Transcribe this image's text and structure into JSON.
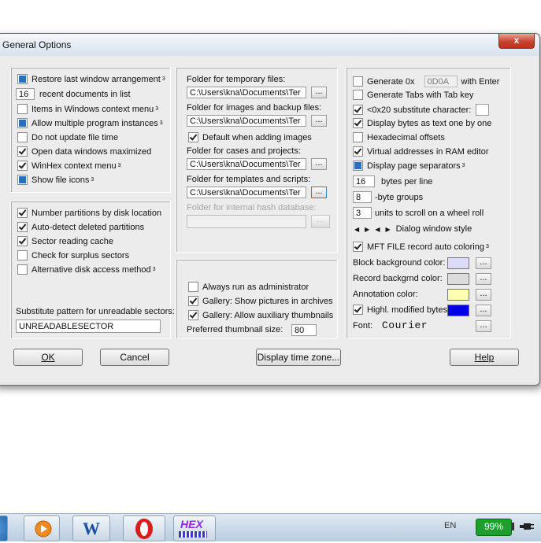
{
  "dialog": {
    "title": "General Options",
    "close_glyph": "x",
    "left_top": {
      "restore_last_window": "Restore last window arrangement",
      "restore_sup": "3",
      "recent_count": "16",
      "recent_label": "recent documents in list",
      "context_menu": "Items in Windows context menu",
      "context_sup": "3",
      "multiple_instances": "Allow multiple program instances",
      "multiple_sup": "3",
      "no_update_time": "Do not update file time",
      "open_maximized": "Open data windows maximized",
      "winhex_context": "WinHex context menu",
      "winhex_sup": "3",
      "show_icons": "Show file icons",
      "icons_sup": "3"
    },
    "left_bottom": {
      "number_partitions": "Number partitions by disk location",
      "auto_detect": "Auto-detect deleted partitions",
      "sector_cache": "Sector reading cache",
      "surplus": "Check for surplus sectors",
      "alt_access": "Alternative disk access method",
      "alt_sup": "3",
      "substitute_label": "Substitute pattern for unreadable sectors:",
      "substitute_value": "UNREADABLESECTOR"
    },
    "middle_top": {
      "temp_label": "Folder for temporary files:",
      "temp_value": "C:\\Users\\kna\\Documents\\Ter",
      "images_label": "Folder for images and backup files:",
      "images_value": "C:\\Users\\kna\\Documents\\Ter",
      "default_adding": "Default when adding images",
      "cases_label": "Folder for cases and projects:",
      "cases_value": "C:\\Users\\kna\\Documents\\Ter",
      "templates_label": "Folder for templates and scripts:",
      "templates_value": "C:\\Users\\kna\\Documents\\Ter",
      "hash_label": "Folder for internal hash database:",
      "hash_value": "",
      "browse": "..."
    },
    "middle_bottom": {
      "run_admin": "Always run as administrator",
      "gallery_archives": "Gallery: Show pictures in archives",
      "gallery_aux": "Gallery: Allow auxiliary thumbnails",
      "thumb_label": "Preferred thumbnail size:",
      "thumb_value": "80"
    },
    "right": {
      "generate_0x": "Generate 0x",
      "generate_0x_value": "0D0A",
      "with_enter": "with Enter",
      "generate_tabs": "Generate Tabs with Tab key",
      "substitute_char": "<0x20 substitute character:",
      "bytes_as_text": "Display bytes as text one by one",
      "hex_offsets": "Hexadecimal offsets",
      "virtual_addr": "Virtual addresses in RAM editor",
      "page_separators": "Display page separators",
      "page_sup": "3",
      "bytes_per_line_value": "16",
      "bytes_per_line": "bytes per line",
      "byte_groups_value": "8",
      "byte_groups": "-byte groups",
      "scroll_units_value": "3",
      "scroll_units": "units to scroll on a wheel roll",
      "dialog_style": "Dialog window style",
      "mft_coloring": "MFT FILE record auto coloring",
      "mft_sup": "3",
      "block_bg": "Block background color:",
      "record_bg": "Record backgrnd color:",
      "annotation": "Annotation color:",
      "highl_modified": "Highl. modified bytes:",
      "font_label": "Font:",
      "font_value": "Courier",
      "browse": "..."
    },
    "buttons": {
      "ok": "OK",
      "cancel": "Cancel",
      "time_zone": "Display time zone...",
      "help": "Help"
    }
  },
  "colors": {
    "block_bg": "#dcdcf8",
    "record_bg": "#dcdcdc",
    "annotation": "#ffffb4",
    "highl_modified": "#0000e6",
    "accent_checkbox": "#2e6db7",
    "battery": "#1e9e2e"
  },
  "taskbar": {
    "language": "EN",
    "battery": "99%",
    "icons": [
      "media-player-icon",
      "word-icon",
      "opera-icon",
      "hex-editor-icon"
    ],
    "hex_icon_text": "HEX",
    "word_letter": "W"
  }
}
